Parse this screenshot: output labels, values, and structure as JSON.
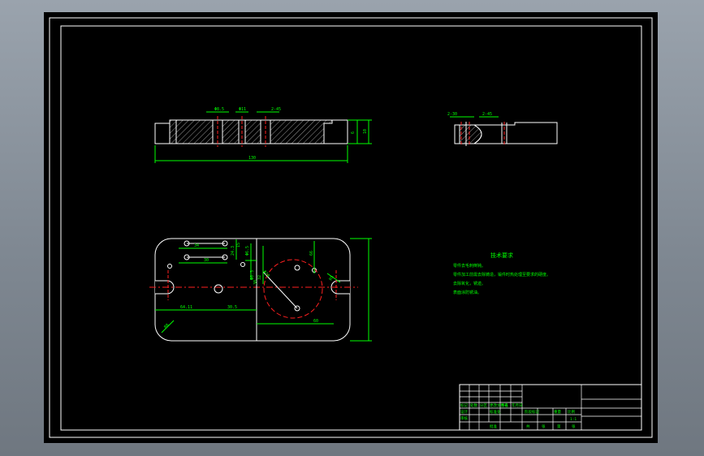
{
  "colors": {
    "background": "#000000",
    "frame": "#ffffff",
    "dimension": "#00ff00",
    "centerline": "#ff2020",
    "hatch": "#ffffff",
    "text": "#00ff00"
  },
  "views": {
    "front_dims": {
      "d1": "Φ8.5",
      "d2": "Φ11",
      "d3": "2-45",
      "height_a": "6",
      "height_b": "10",
      "length": "130"
    },
    "side_dims": {
      "d1": "2-30",
      "d2": "2-45"
    },
    "plan_dims": {
      "a": "34",
      "b": "30",
      "c": "24.3",
      "d": "15",
      "e": "Φ6.5",
      "f": "Φ8.3",
      "g": "32",
      "h": "66",
      "i": "R8",
      "j": "Φ10",
      "k": "R5",
      "l": "30",
      "m": "64.11",
      "n": "30.5",
      "o": "60"
    }
  },
  "notes": {
    "title": "技术要求",
    "lines": [
      "零件去毛刺倒钝。",
      "零件加工前需去除铸造，锻件时热处理至要求的硬度。",
      "去除氧化，锈迹。",
      "表面涂防锈油。"
    ]
  },
  "title_block": {
    "row1": [
      "标记",
      "处数",
      "分区",
      "更改文件号",
      "签名",
      "年月日"
    ],
    "row2": [
      "设计",
      "",
      "",
      "标准化",
      "",
      ""
    ],
    "labels": [
      "阶段标记",
      "重量",
      "比例"
    ],
    "scale": "1:1",
    "sheet": [
      "共",
      "张",
      "第",
      "张"
    ],
    "approve": "批准",
    "check": "审核"
  }
}
